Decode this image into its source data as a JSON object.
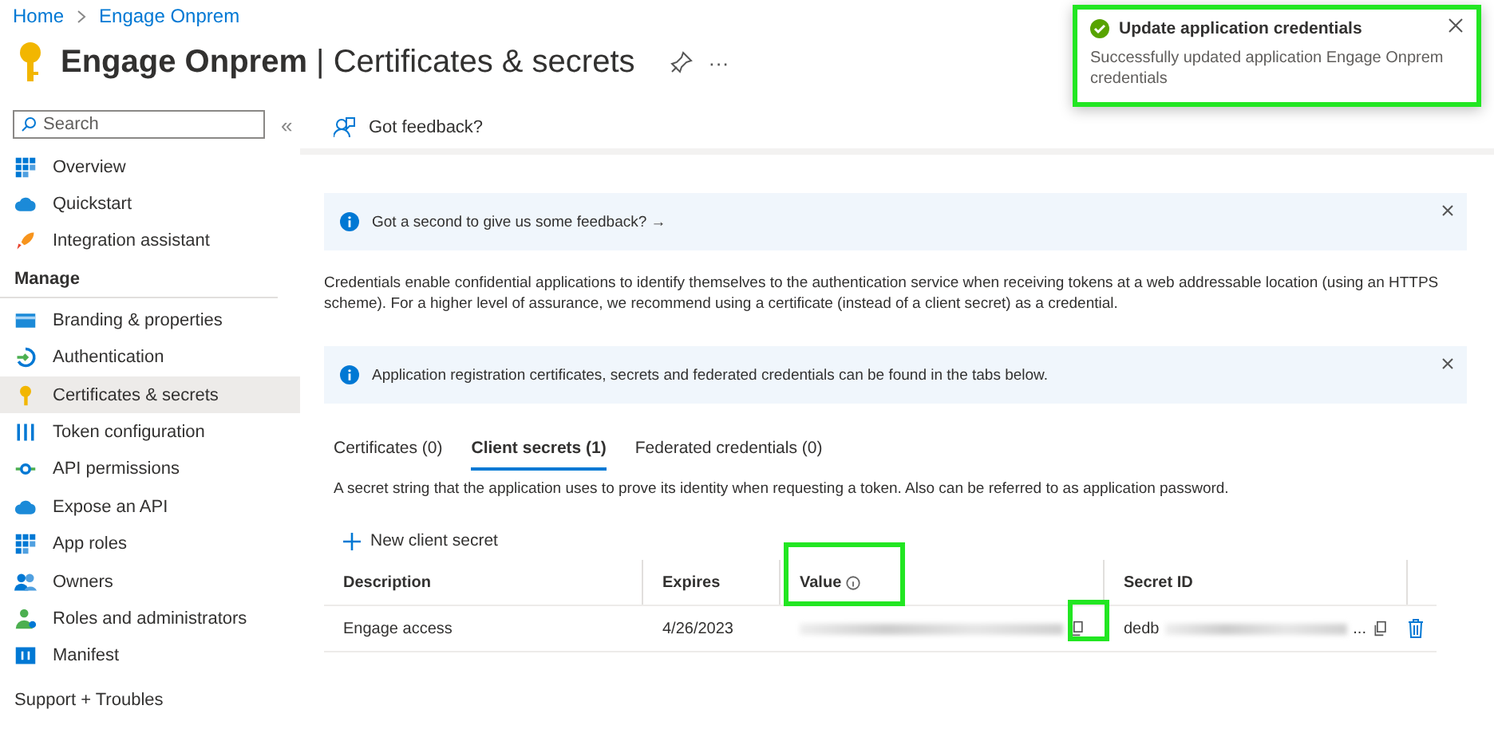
{
  "breadcrumb": [
    "Home",
    "Engage Onprem"
  ],
  "title": {
    "app": "Engage Onprem",
    "separator": "|",
    "page": "Certificates & secrets"
  },
  "title_actions": {
    "more": "···"
  },
  "search": {
    "placeholder": "Search"
  },
  "collapse": "«",
  "sidebar": {
    "top_items": [
      {
        "label": "Overview",
        "kind": "grid",
        "selected": false
      },
      {
        "label": "Quickstart",
        "kind": "cloud",
        "selected": false
      },
      {
        "label": "Integration assistant",
        "kind": "rocket",
        "selected": false
      }
    ],
    "section": "Manage",
    "items": [
      {
        "label": "Branding & properties",
        "kind": "card",
        "selected": false
      },
      {
        "label": "Authentication",
        "kind": "auth",
        "selected": false
      },
      {
        "label": "Certificates & secrets",
        "kind": "key",
        "selected": true
      },
      {
        "label": "Token configuration",
        "kind": "bars",
        "selected": false
      },
      {
        "label": "API permissions",
        "kind": "api",
        "selected": false
      },
      {
        "label": "Expose an API",
        "kind": "cloud",
        "selected": false
      },
      {
        "label": "App roles",
        "kind": "grid",
        "selected": false
      },
      {
        "label": "Owners",
        "kind": "people",
        "selected": false
      },
      {
        "label": "Roles and administrators",
        "kind": "person",
        "selected": false
      },
      {
        "label": "Manifest",
        "kind": "manifest",
        "selected": false
      }
    ],
    "next_section": "Support + Troubles"
  },
  "toolbar": {
    "feedback": "Got feedback?"
  },
  "feedback_banner": {
    "text": "Got a second to give us some feedback? →"
  },
  "description": "Credentials enable confidential applications to identify themselves to the authentication service when receiving tokens at a web addressable location (using an HTTPS scheme). For a higher level of assurance, we recommend using a certificate (instead of a client secret) as a credential.",
  "info_banner": {
    "text": "Application registration certificates, secrets and federated credentials can be found in the tabs below."
  },
  "tabs": [
    {
      "label": "Certificates (0)",
      "selected": false
    },
    {
      "label": "Client secrets (1)",
      "selected": true
    },
    {
      "label": "Federated credentials (0)",
      "selected": false
    }
  ],
  "tab_description": "A secret string that the application uses to prove its identity when requesting a token. Also can be referred to as application password.",
  "new_secret": "New client secret",
  "table": {
    "columns": [
      "Description",
      "Expires",
      "Value",
      "Secret ID"
    ],
    "rows": [
      {
        "description": "Engage access",
        "expires": "4/26/2023",
        "secret_id": "dedb",
        "secret_id_end": "..."
      }
    ]
  },
  "toast": {
    "title": "Update application credentials",
    "message": "Successfully updated application Engage Onprem credentials"
  }
}
